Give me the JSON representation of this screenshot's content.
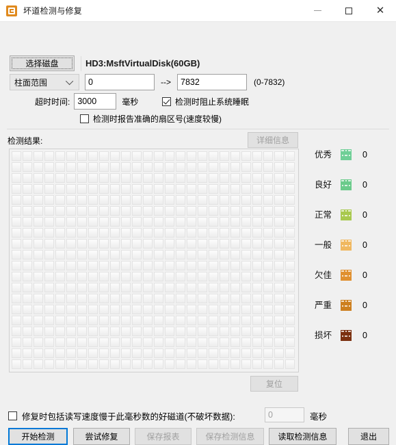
{
  "window": {
    "title": "坏道检测与修复",
    "icon": "app-icon",
    "minimize_label": "",
    "maximize_label": "",
    "close_label": "✕"
  },
  "disk_row": {
    "select_disk_button": "选择磁盘",
    "disk_name": "HD3:MsftVirtualDisk(60GB)"
  },
  "range_row": {
    "mode_select": "柱面范围",
    "from_value": "0",
    "arrow": "-->",
    "to_value": "7832",
    "hint": "(0-7832)"
  },
  "timeout_row": {
    "label": "超时时间:",
    "value": "3000",
    "unit": "毫秒"
  },
  "options": {
    "prevent_sleep": {
      "label": "检测时阻止系统睡眠",
      "checked": true
    },
    "report_exact_sector": {
      "label": "检测时报告准确的扇区号(速度较慢)",
      "checked": false
    }
  },
  "results": {
    "label": "检测结果:",
    "detail_button": "详细信息",
    "reset_button": "复位",
    "grid_columns": 26,
    "grid_rows": 20
  },
  "legend": [
    {
      "name": "优秀",
      "count": "0",
      "color": "#6fcf97"
    },
    {
      "name": "良好",
      "count": "0",
      "color": "#6bcb8b"
    },
    {
      "name": "正常",
      "count": "0",
      "color": "#a9c94f"
    },
    {
      "name": "一般",
      "count": "0",
      "color": "#f0b860"
    },
    {
      "name": "欠佳",
      "count": "0",
      "color": "#e09030"
    },
    {
      "name": "严重",
      "count": "0",
      "color": "#cd7f1f"
    },
    {
      "name": "损坏",
      "count": "0",
      "color": "#7b3010"
    }
  ],
  "slow_track": {
    "checkbox_label": "修复时包括读写速度慢于此毫秒数的好磁道(不破坏数据):",
    "checked": false,
    "value": "0",
    "unit": "毫秒"
  },
  "buttons": {
    "start": "开始检测",
    "repair": "尝试修复",
    "save_report": "保存报表",
    "save_info": "保存检测信息",
    "load_info": "读取检测信息",
    "exit": "退出"
  },
  "colors": {
    "accent": "#0078d7",
    "window_bg": "#f0f0f0",
    "titlebar_bg": "#ffffff"
  }
}
